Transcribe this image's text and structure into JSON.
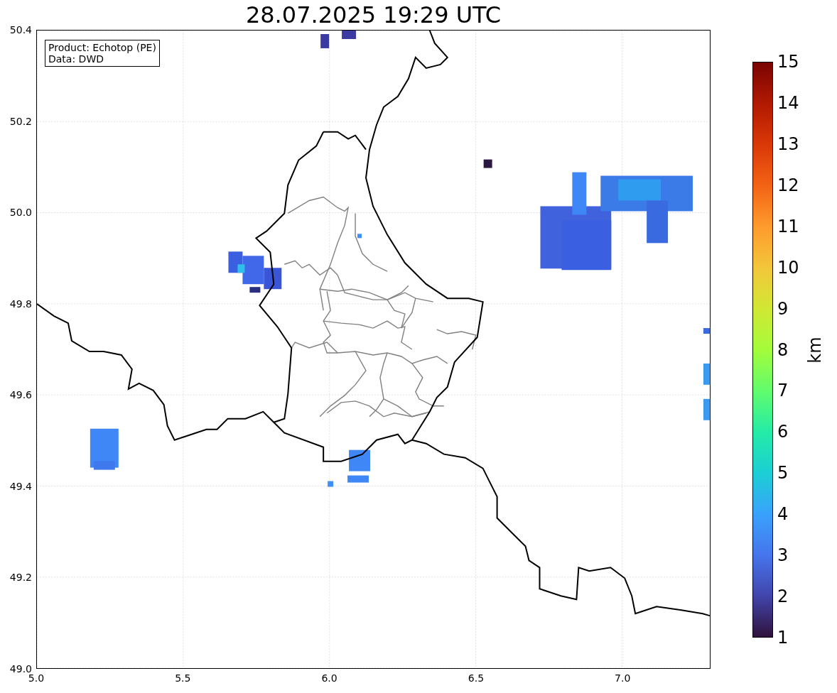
{
  "title": "28.07.2025 19:29 UTC",
  "legend": [
    "Product: Echotop (PE)",
    "Data: DWD"
  ],
  "y_ticks": [
    "50.4",
    "50.2",
    "50.0",
    "49.8",
    "49.6",
    "49.4",
    "49.2",
    "49.0"
  ],
  "x_ticks": [
    "5.0",
    "5.5",
    "6.0",
    "6.5",
    "7.0"
  ],
  "colorbar": {
    "label": "km",
    "ticks": [
      "15",
      "14",
      "13",
      "12",
      "11",
      "10",
      "9",
      "8",
      "7",
      "6",
      "5",
      "4",
      "3",
      "2",
      "1"
    ]
  }
}
